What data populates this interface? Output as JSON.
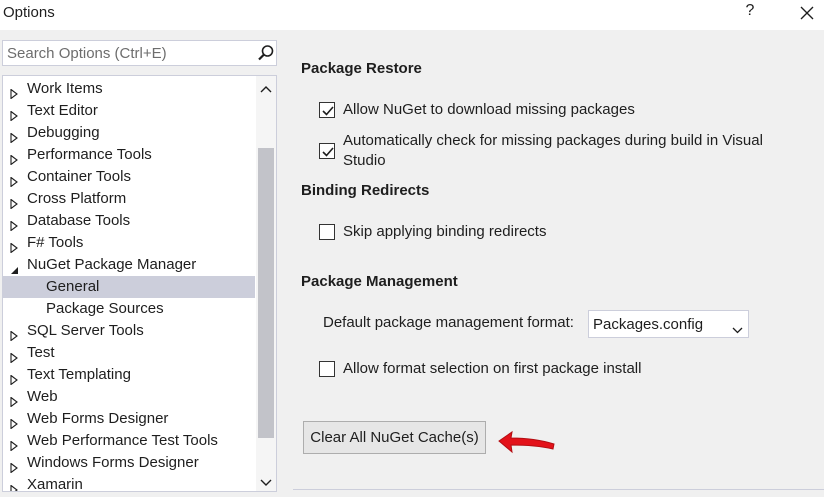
{
  "window": {
    "title": "Options",
    "help_label": "?",
    "close_icon": "close-icon"
  },
  "search": {
    "placeholder": "Search Options (Ctrl+E)",
    "icon": "search-icon"
  },
  "tree": {
    "items": [
      {
        "label": "Work Items",
        "expander": "collapsed",
        "level": 0,
        "selected": false
      },
      {
        "label": "Text Editor",
        "expander": "collapsed",
        "level": 0,
        "selected": false
      },
      {
        "label": "Debugging",
        "expander": "collapsed",
        "level": 0,
        "selected": false
      },
      {
        "label": "Performance Tools",
        "expander": "collapsed",
        "level": 0,
        "selected": false
      },
      {
        "label": "Container Tools",
        "expander": "collapsed",
        "level": 0,
        "selected": false
      },
      {
        "label": "Cross Platform",
        "expander": "collapsed",
        "level": 0,
        "selected": false
      },
      {
        "label": "Database Tools",
        "expander": "collapsed",
        "level": 0,
        "selected": false
      },
      {
        "label": "F# Tools",
        "expander": "collapsed",
        "level": 0,
        "selected": false
      },
      {
        "label": "NuGet Package Manager",
        "expander": "expanded",
        "level": 0,
        "selected": false
      },
      {
        "label": "General",
        "expander": "none",
        "level": 1,
        "selected": true
      },
      {
        "label": "Package Sources",
        "expander": "none",
        "level": 1,
        "selected": false
      },
      {
        "label": "SQL Server Tools",
        "expander": "collapsed",
        "level": 0,
        "selected": false
      },
      {
        "label": "Test",
        "expander": "collapsed",
        "level": 0,
        "selected": false
      },
      {
        "label": "Text Templating",
        "expander": "collapsed",
        "level": 0,
        "selected": false
      },
      {
        "label": "Web",
        "expander": "collapsed",
        "level": 0,
        "selected": false
      },
      {
        "label": "Web Forms Designer",
        "expander": "collapsed",
        "level": 0,
        "selected": false
      },
      {
        "label": "Web Performance Test Tools",
        "expander": "collapsed",
        "level": 0,
        "selected": false
      },
      {
        "label": "Windows Forms Designer",
        "expander": "collapsed",
        "level": 0,
        "selected": false
      },
      {
        "label": "Xamarin",
        "expander": "collapsed",
        "level": 0,
        "selected": false
      }
    ]
  },
  "settings": {
    "package_restore": {
      "title": "Package Restore",
      "allow_download": {
        "label": "Allow NuGet to download missing packages",
        "checked": true
      },
      "auto_check": {
        "label": "Automatically check for missing packages during build in Visual Studio",
        "checked": true
      }
    },
    "binding_redirects": {
      "title": "Binding Redirects",
      "skip_redirects": {
        "label": "Skip applying binding redirects",
        "checked": false
      }
    },
    "package_management": {
      "title": "Package Management",
      "format_label": "Default package management format:",
      "format_value": "Packages.config",
      "allow_format_selection": {
        "label": "Allow format selection on first package install",
        "checked": false
      }
    },
    "clear_cache_label": "Clear All NuGet Cache(s)"
  },
  "colors": {
    "selected_item": "#cccedb",
    "annotation_arrow": "#e3121a",
    "window_bg": "#f0f0f0"
  }
}
